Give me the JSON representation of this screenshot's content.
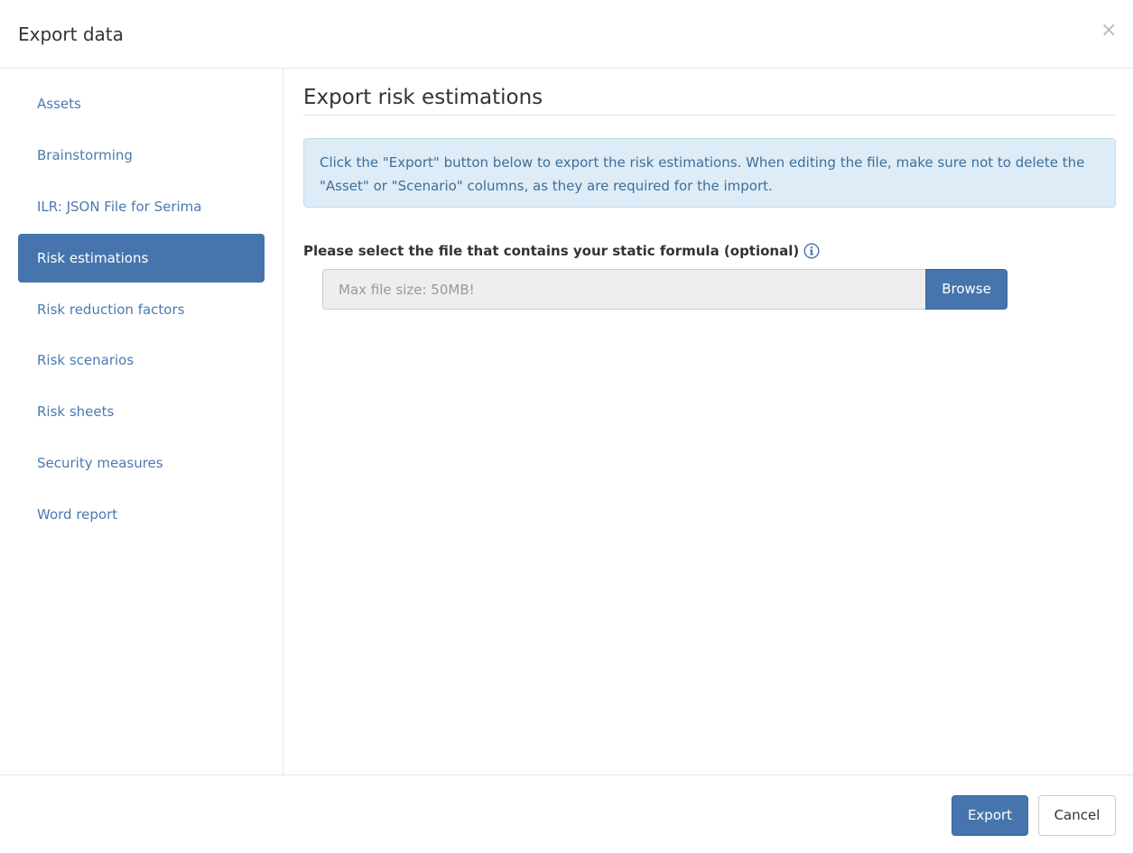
{
  "dialog": {
    "title": "Export data",
    "close_glyph": "×"
  },
  "sidebar": {
    "items": [
      {
        "label": "Assets",
        "active": false
      },
      {
        "label": "Brainstorming",
        "active": false
      },
      {
        "label": "ILR: JSON File for Serima",
        "active": false
      },
      {
        "label": "Risk estimations",
        "active": true
      },
      {
        "label": "Risk reduction factors",
        "active": false
      },
      {
        "label": "Risk scenarios",
        "active": false
      },
      {
        "label": "Risk sheets",
        "active": false
      },
      {
        "label": "Security measures",
        "active": false
      },
      {
        "label": "Word report",
        "active": false
      }
    ]
  },
  "main": {
    "title": "Export risk estimations",
    "info_text": "Click the \"Export\" button below to export the risk estimations. When editing the file, make sure not to delete the \"Asset\" or \"Scenario\" columns, as they are required for the import.",
    "file_label": "Please select the file that contains your static formula (optional)",
    "file_placeholder": "Max file size: 50MB!",
    "browse_label": "Browse"
  },
  "footer": {
    "export_label": "Export",
    "cancel_label": "Cancel"
  },
  "colors": {
    "accent": "#4675ad",
    "link": "#4a7ab0",
    "alert_bg": "#deecf7",
    "alert_text": "#3e6f98"
  },
  "icons": {
    "close": "close-icon",
    "info": "info-icon"
  }
}
